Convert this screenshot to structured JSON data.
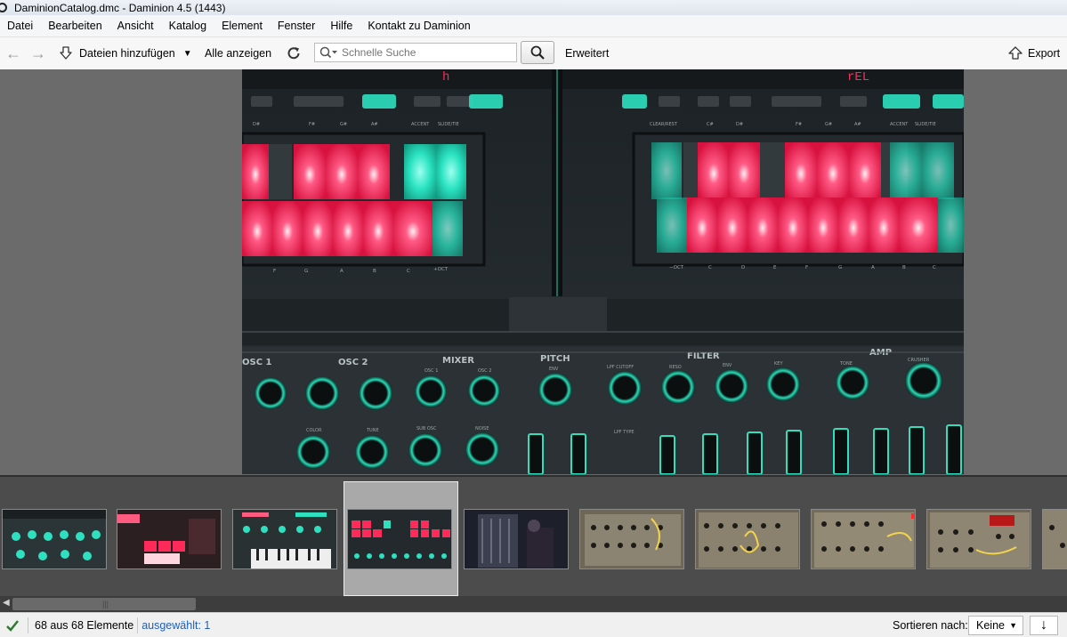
{
  "window": {
    "title": "DaminionCatalog.dmc - Daminion 4.5 (1443)"
  },
  "menu": [
    "Datei",
    "Bearbeiten",
    "Ansicht",
    "Katalog",
    "Element",
    "Fenster",
    "Hilfe",
    "Kontakt zu Daminion"
  ],
  "toolbar": {
    "add_files_label": "Dateien hinzufügen",
    "show_all_label": "Alle anzeigen",
    "search_placeholder": "Schnelle Suche",
    "advanced_label": "Erweitert",
    "export_label": "Export"
  },
  "photo_labels": {
    "sections": [
      "OSC 1",
      "OSC 2",
      "MIXER",
      "PITCH",
      "FILTER",
      "AMP"
    ],
    "knob_labels": [
      "OSC 1",
      "OSC 2",
      "ENV",
      "LPF CUTOFF",
      "RESO",
      "ENV",
      "KEY",
      "TONE",
      "CRUSHER",
      "COLOR",
      "TUNE",
      "SUB OSC",
      "NOISE",
      "LPF TYPE"
    ],
    "left_note_labels": [
      "F",
      "G",
      "A",
      "B",
      "C",
      "+OCT"
    ],
    "right_note_labels": [
      "−OCT",
      "C",
      "D",
      "E",
      "F",
      "G",
      "A",
      "B",
      "C"
    ],
    "top_labels_left": [
      "D#",
      "F#",
      "G#",
      "A#",
      "ACCENT",
      "SLIDE/TIE"
    ],
    "top_labels_right": [
      "CLEAR/REST",
      "C#",
      "D#",
      "F#",
      "G#",
      "A#",
      "ACCENT",
      "SLIDE/TIE"
    ]
  },
  "thumbnails": [
    {
      "name": "synth-green-knobs",
      "selected": false
    },
    {
      "name": "synth-red-pads",
      "selected": false
    },
    {
      "name": "synth-keyboard",
      "selected": false
    },
    {
      "name": "synth-step-sequencer",
      "selected": true
    },
    {
      "name": "modular-dark",
      "selected": false
    },
    {
      "name": "modular-patch-1",
      "selected": false
    },
    {
      "name": "modular-patch-2",
      "selected": false
    },
    {
      "name": "modular-patch-3",
      "selected": false
    },
    {
      "name": "modular-patch-4",
      "selected": false
    }
  ],
  "status": {
    "count_text": "68 aus 68 Elemente",
    "selected_text": "ausgewählt: 1",
    "sort_label": "Sortieren nach:",
    "sort_value": "Keine"
  },
  "colors": {
    "accent_link": "#1f5fb8",
    "pad_red": "#ff2a5a",
    "pad_green": "#2fe6c0",
    "checkmark": "#2c7a2c"
  }
}
